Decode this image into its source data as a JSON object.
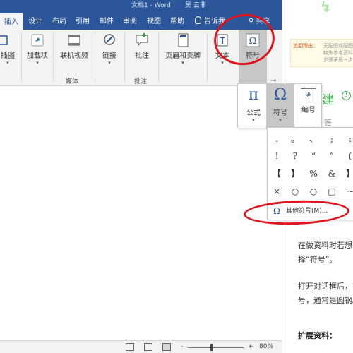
{
  "titlebar": {
    "title": "文档1 - Word",
    "user": "吴 云非"
  },
  "tabs": [
    {
      "label": "插入",
      "active": true
    },
    {
      "label": "设计"
    },
    {
      "label": "布局"
    },
    {
      "label": "引用"
    },
    {
      "label": "邮件"
    },
    {
      "label": "审阅"
    },
    {
      "label": "视图"
    },
    {
      "label": "帮助"
    },
    {
      "label": "告诉我"
    },
    {
      "label": "共享"
    }
  ],
  "ribbon": {
    "smartart": "插图",
    "addins": "加载项",
    "online_video": "联机视频",
    "link": "链接",
    "comment": "批注",
    "header_footer": "页眉和页脚",
    "text": "文本",
    "symbols": "符号",
    "groups": {
      "media": "媒体",
      "comments": "批注"
    }
  },
  "symbol_menu": {
    "equation": "公式",
    "symbol": "符号",
    "numbering": "编号",
    "grid": [
      [
        ".",
        "。",
        "、",
        ";",
        ":"
      ],
      [
        "!",
        "?",
        "“",
        "”",
        "("
      ],
      [
        "【",
        "】",
        "%",
        "&",
        "】"
      ],
      [
        "×",
        "○",
        "○",
        "□",
        "~"
      ]
    ],
    "more_symbols": "其他符号(M)..."
  },
  "right_panel": {
    "report_tag": "追回理由：",
    "small_line1": "无配图或配图",
    "small_line2": "缺失参考资料",
    "small_line3": "步骤矛盾一步",
    "heading": "建",
    "answer_label": "答",
    "para1_line1": "在做资料时若想在",
    "para1_line2": "择“符号”。",
    "para2_line1": "打开对话框后，在",
    "para2_line2": "号，通常是圆钢。",
    "extended": "扩展资料："
  },
  "statusbar": {
    "zoom": "80%",
    "minus": "-",
    "plus": "+"
  },
  "colors": {
    "word_blue": "#2b579a",
    "annotation_red": "#e0141e",
    "brand_green": "#38b24a"
  }
}
